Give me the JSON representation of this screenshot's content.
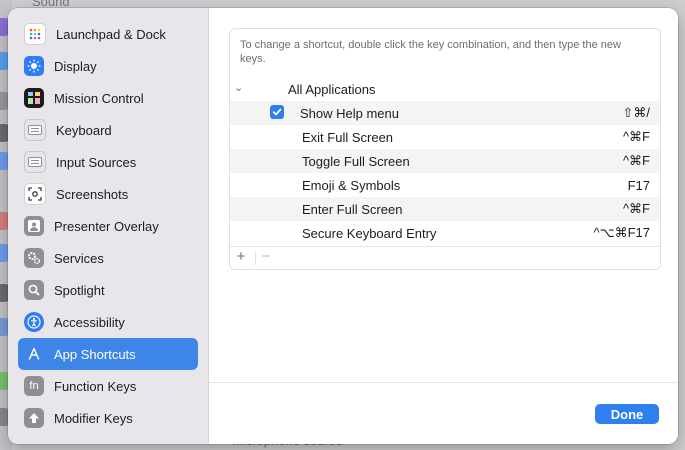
{
  "background": {
    "top_text": "Sound",
    "bottom_text": "Microphone source"
  },
  "sidebar": {
    "items": [
      {
        "label": "Launchpad & Dock",
        "icon": "launchpad-icon",
        "color": "#ffffff"
      },
      {
        "label": "Display",
        "icon": "display-icon",
        "color": "#2e7cf6"
      },
      {
        "label": "Mission Control",
        "icon": "mission-control-icon",
        "color": "#1c1c1e"
      },
      {
        "label": "Keyboard",
        "icon": "keyboard-icon",
        "color": "#c7c7cc"
      },
      {
        "label": "Input Sources",
        "icon": "input-sources-icon",
        "color": "#c7c7cc"
      },
      {
        "label": "Screenshots",
        "icon": "screenshot-icon",
        "color": "#ffffff"
      },
      {
        "label": "Presenter Overlay",
        "icon": "presenter-overlay-icon",
        "color": "#8e8e93"
      },
      {
        "label": "Services",
        "icon": "gear-icon",
        "color": "#8e8e93"
      },
      {
        "label": "Spotlight",
        "icon": "spotlight-icon",
        "color": "#8e8e93"
      },
      {
        "label": "Accessibility",
        "icon": "accessibility-icon",
        "color": "#2e7cf6"
      },
      {
        "label": "App Shortcuts",
        "icon": "app-store-icon",
        "color": "#3d86e8"
      },
      {
        "label": "Function Keys",
        "icon": "fn-key-icon",
        "color": "#8e8e93"
      },
      {
        "label": "Modifier Keys",
        "icon": "modifier-keys-icon",
        "color": "#8e8e93"
      }
    ],
    "active_index": 10,
    "active_color": "#3d86e8"
  },
  "shortcuts": {
    "instructions": "To change a shortcut, double click the key combination, and then type the new keys.",
    "group_label": "All Applications",
    "rows": [
      {
        "name": "Show Help menu",
        "keys": "⇧⌘/",
        "checked": true
      },
      {
        "name": "Exit Full Screen",
        "keys": "^⌘F"
      },
      {
        "name": "Toggle Full Screen",
        "keys": "^⌘F"
      },
      {
        "name": "Emoji & Symbols",
        "keys": "F17"
      },
      {
        "name": "Enter Full Screen",
        "keys": "^⌘F"
      },
      {
        "name": "Secure Keyboard Entry",
        "keys": "^⌥⌘F17"
      }
    ],
    "add_label": "+",
    "remove_label": "−"
  },
  "footer": {
    "done_label": "Done",
    "accent": "#2f7ff0"
  }
}
